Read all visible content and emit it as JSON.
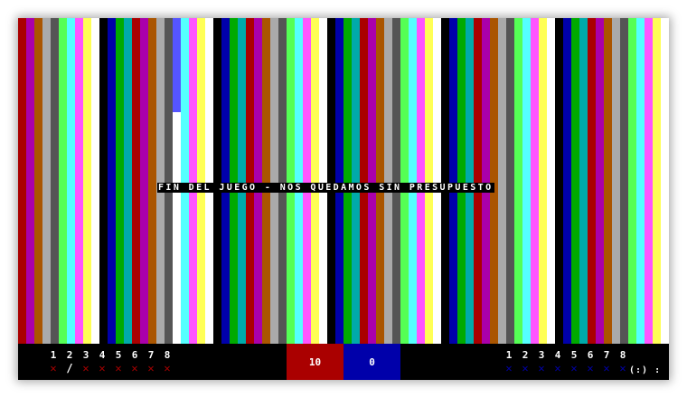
{
  "message": "FIN DEL JUEGO - NOS QUEDAMOS SIN PRESUPUESTO",
  "palette": [
    "#aa0000",
    "#aa00aa",
    "#aa5500",
    "#aaaaaa",
    "#555555",
    "#5555ff",
    "#55ff55",
    "#55ffff",
    "#ff5555",
    "#ff55ff",
    "#ffff55",
    "#ffffff",
    "#000000",
    "#0000aa",
    "#00aa00",
    "#00aaaa"
  ],
  "stripe_sequence": [
    0,
    1,
    2,
    3,
    4,
    6,
    7,
    9,
    10,
    11,
    12,
    13,
    14,
    15
  ],
  "hud": {
    "left_player": {
      "color": "#aa0000",
      "slots": [
        {
          "num": "1",
          "mark": "✕"
        },
        {
          "num": "2",
          "mark": "/"
        },
        {
          "num": "3",
          "mark": "✕"
        },
        {
          "num": "4",
          "mark": "✕"
        },
        {
          "num": "5",
          "mark": "✕"
        },
        {
          "num": "6",
          "mark": "✕"
        },
        {
          "num": "7",
          "mark": "✕"
        },
        {
          "num": "8",
          "mark": "✕"
        }
      ]
    },
    "score_red": "10",
    "score_blue": "0",
    "right_player": {
      "color": "#0000aa",
      "slots": [
        {
          "num": "1",
          "mark": "✕"
        },
        {
          "num": "2",
          "mark": "✕"
        },
        {
          "num": "3",
          "mark": "✕"
        },
        {
          "num": "4",
          "mark": "✕"
        },
        {
          "num": "5",
          "mark": "✕"
        },
        {
          "num": "6",
          "mark": "✕"
        },
        {
          "num": "7",
          "mark": "✕"
        },
        {
          "num": "8",
          "mark": "✕"
        }
      ]
    },
    "indicator": "(:) :"
  }
}
